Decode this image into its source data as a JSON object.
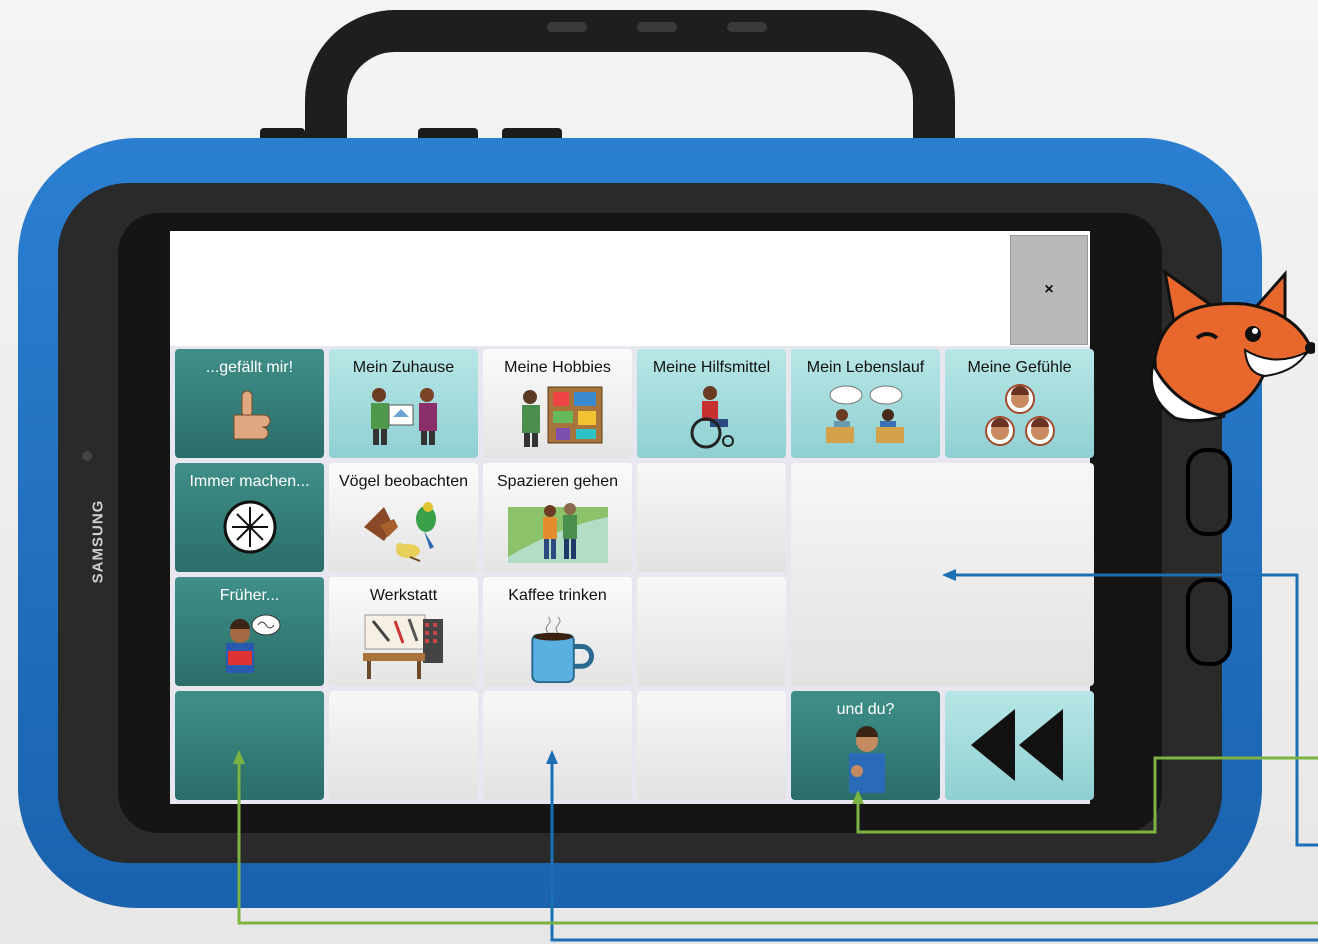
{
  "device": {
    "brand": "SAMSUNG"
  },
  "close_button": {
    "label": "×"
  },
  "grid": {
    "row1": [
      {
        "label": "...gefällt mir!",
        "icon": "thumbs-up-icon"
      },
      {
        "label": "Mein Zuhause",
        "icon": "house-visit-icon"
      },
      {
        "label": "Meine Hobbies",
        "icon": "hobbies-board-icon"
      },
      {
        "label": "Meine Hilfsmittel",
        "icon": "wheelchair-icon"
      },
      {
        "label": "Mein Lebenslauf",
        "icon": "conversation-icon"
      },
      {
        "label": "Meine Gefühle",
        "icon": "faces-icon"
      }
    ],
    "row2": [
      {
        "label": "Immer machen...",
        "icon": "clock-icon"
      },
      {
        "label": "Vögel beobachten",
        "icon": "birds-icon"
      },
      {
        "label": "Spazieren gehen",
        "icon": "walking-icon"
      }
    ],
    "row3": [
      {
        "label": "Früher...",
        "icon": "reading-man-icon"
      },
      {
        "label": "Werkstatt",
        "icon": "workshop-icon"
      },
      {
        "label": "Kaffee trinken",
        "icon": "coffee-mug-icon"
      }
    ],
    "row4": [
      {
        "label": "und du?",
        "icon": "pointing-man-icon"
      },
      {
        "label": "",
        "icon": "rewind-icon"
      }
    ]
  },
  "colors": {
    "bumper": "#1f6fc0",
    "teal": "#2f7570",
    "aqua": "#a4dcdd",
    "arrow_blue": "#1c6fb5",
    "arrow_green": "#7cb342"
  }
}
